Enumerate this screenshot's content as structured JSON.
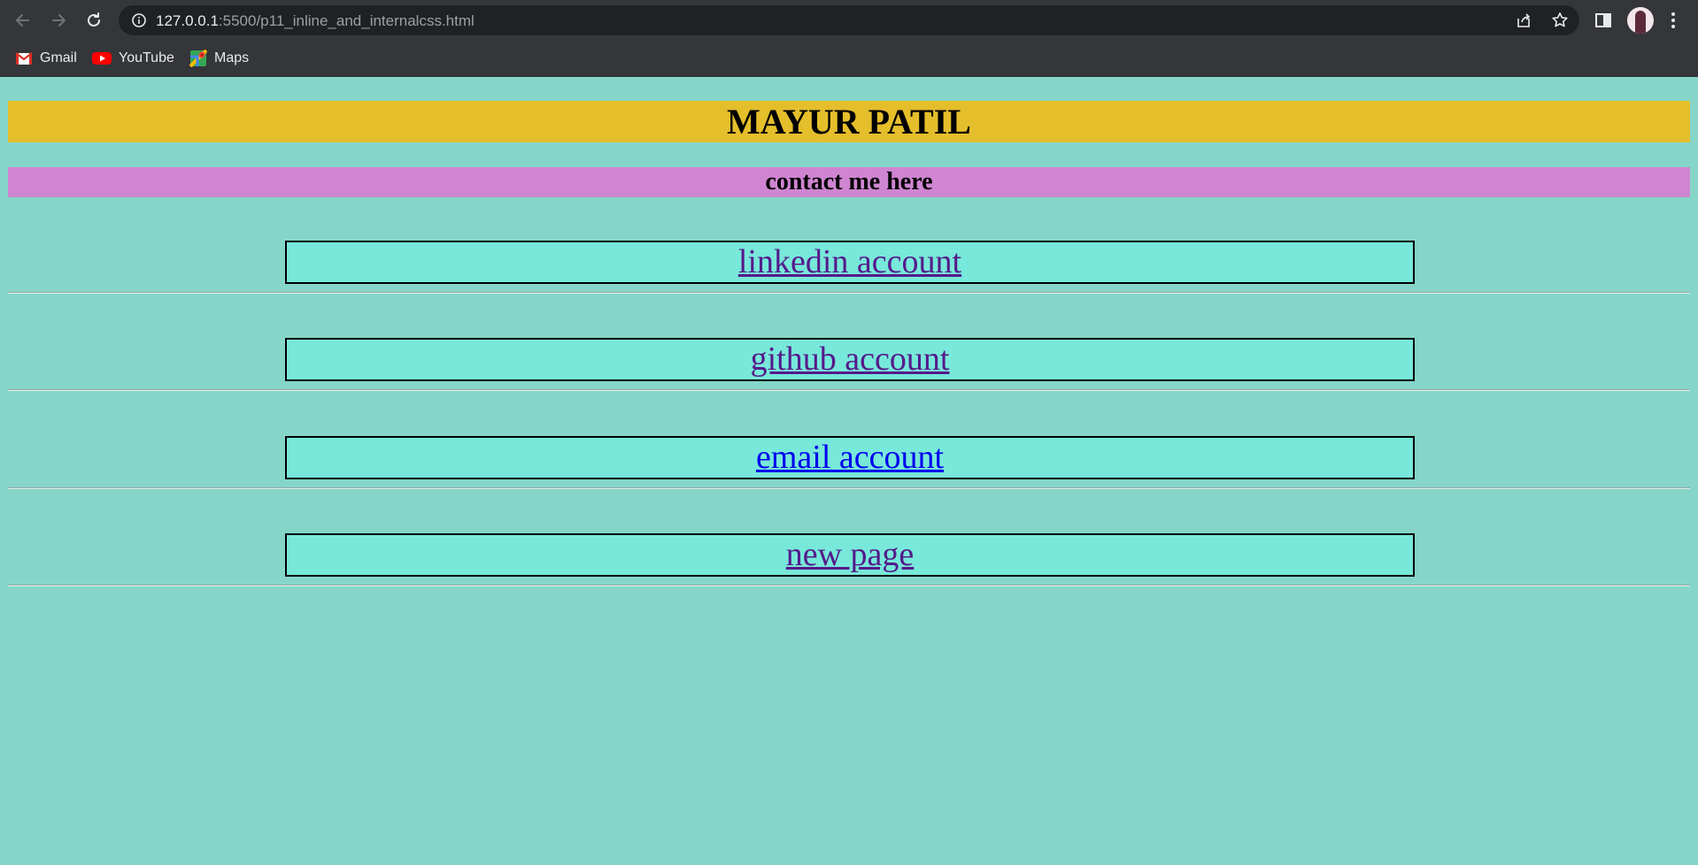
{
  "browser": {
    "url_host": "127.0.0.1",
    "url_rest": ":5500/p11_inline_and_internalcss.html",
    "bookmarks": [
      {
        "label": "Gmail",
        "icon": "gmail-icon"
      },
      {
        "label": "YouTube",
        "icon": "youtube-icon"
      },
      {
        "label": "Maps",
        "icon": "maps-icon"
      }
    ],
    "colors": {
      "toolbar": "#35363a",
      "omnibox": "#202124"
    }
  },
  "page": {
    "title": "MAYUR PATIL",
    "subtitle": "contact me here",
    "links": [
      {
        "label": "linkedin account",
        "visited": true
      },
      {
        "label": "github account",
        "visited": true
      },
      {
        "label": "email account",
        "visited": false
      },
      {
        "label": "new page",
        "visited": true
      }
    ],
    "colors": {
      "background": "#85d6c9",
      "title_bar": "#e5be2b",
      "contact_bar": "#cf85d1",
      "link_box": "#77e8d9"
    }
  }
}
